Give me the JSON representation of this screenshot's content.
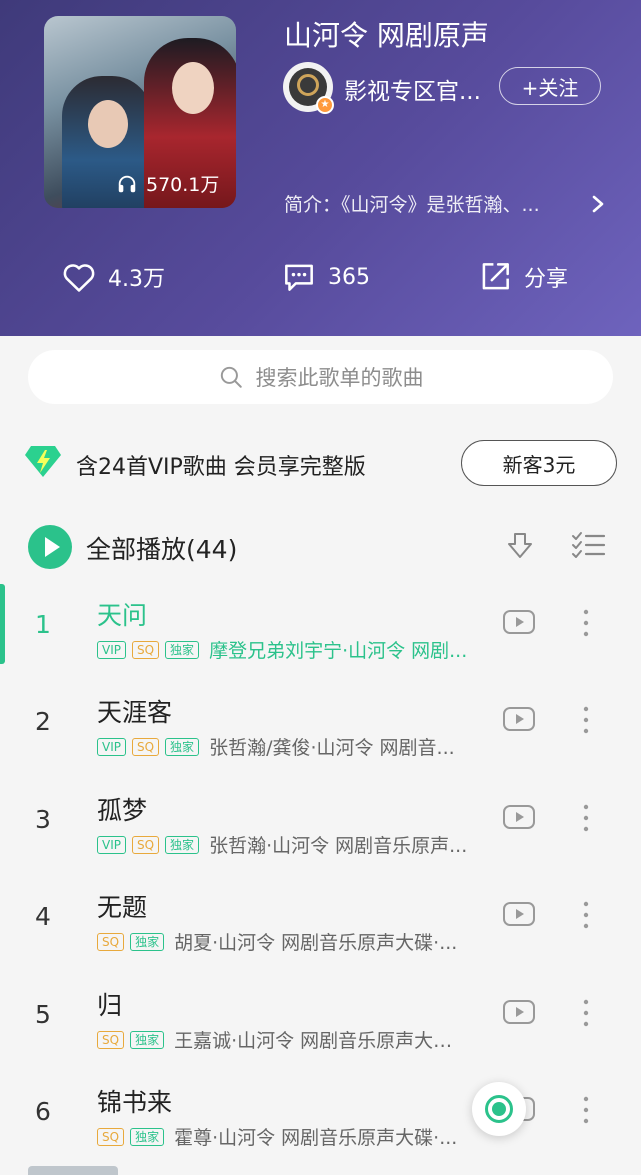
{
  "playlist": {
    "title": "山河令 网剧原声",
    "play_count": "570.1万",
    "uploader": "影视专区官...",
    "follow_label": "+关注",
    "intro": "简介：《山河令》是张哲瀚、..."
  },
  "actions": {
    "likes": "4.3万",
    "comments": "365",
    "share": "分享"
  },
  "search": {
    "placeholder": "搜索此歌单的歌曲"
  },
  "vip_banner": {
    "text": "含24首VIP歌曲 会员享完整版",
    "button": "新客3元"
  },
  "play_all": {
    "label": "全部播放(44)"
  },
  "tags": {
    "vip": "VIP",
    "sq": "SQ",
    "exclusive": "独家"
  },
  "songs": [
    {
      "index": "1",
      "title": "天问",
      "artist": "摩登兄弟刘宇宁·山河令 网剧...",
      "active": true
    },
    {
      "index": "2",
      "title": "天涯客",
      "artist": "张哲瀚/龚俊·山河令 网剧音...",
      "active": false
    },
    {
      "index": "3",
      "title": "孤梦",
      "artist": "张哲瀚·山河令 网剧音乐原声...",
      "active": false
    },
    {
      "index": "4",
      "title": "无题",
      "artist": "胡夏·山河令 网剧音乐原声大碟·...",
      "active": false
    },
    {
      "index": "5",
      "title": "归",
      "artist": "王嘉诚·山河令 网剧音乐原声大碟...",
      "active": false
    },
    {
      "index": "6",
      "title": "锦书来",
      "artist": "霍尊·山河令 网剧音乐原声大碟·...",
      "active": false
    }
  ],
  "colors": {
    "accent": "#2bc28b",
    "sq": "#e8a93c",
    "header": "#574b9c"
  }
}
